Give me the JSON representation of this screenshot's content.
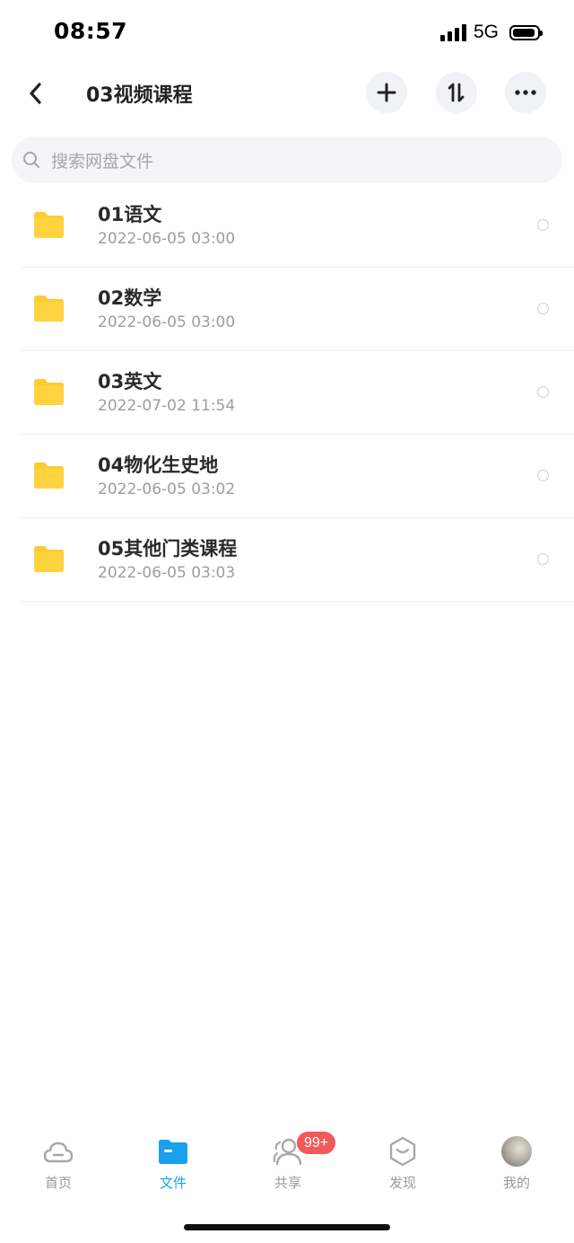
{
  "status": {
    "time": "08:57",
    "network": "5G"
  },
  "header": {
    "title": "03视频课程"
  },
  "search": {
    "placeholder": "搜索网盘文件"
  },
  "files": [
    {
      "name": "01语文",
      "date": "2022-06-05 03:00"
    },
    {
      "name": "02数学",
      "date": "2022-06-05 03:00"
    },
    {
      "name": "03英文",
      "date": "2022-07-02 11:54"
    },
    {
      "name": "04物化生史地",
      "date": "2022-06-05 03:02"
    },
    {
      "name": "05其他门类课程",
      "date": "2022-06-05 03:03"
    }
  ],
  "tabs": [
    {
      "label": "首页",
      "icon": "cloud-icon"
    },
    {
      "label": "文件",
      "icon": "folder-icon",
      "active": true
    },
    {
      "label": "共享",
      "icon": "people-icon",
      "badge": "99+"
    },
    {
      "label": "发现",
      "icon": "discover-icon"
    },
    {
      "label": "我的",
      "icon": "avatar"
    }
  ],
  "colors": {
    "accent": "#1aa0ef",
    "folder": "#ffcb2f",
    "badge": "#f25a5a"
  }
}
